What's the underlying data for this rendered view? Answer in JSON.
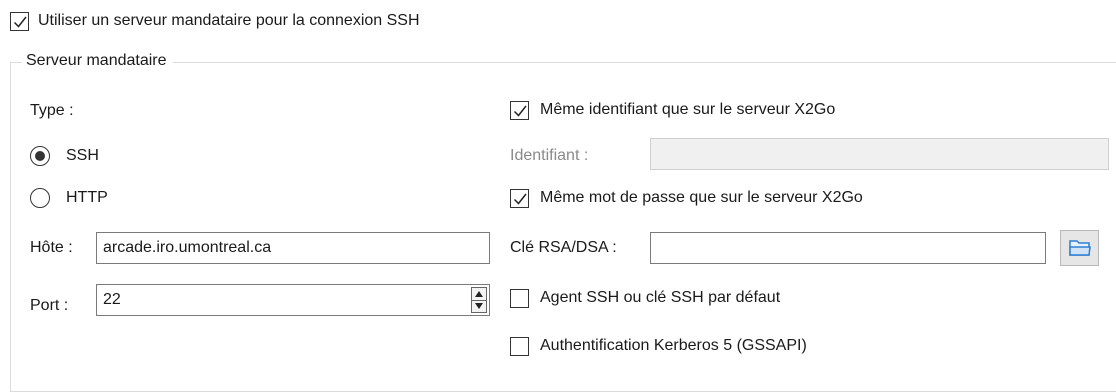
{
  "use_proxy": {
    "label": "Utiliser un serveur mandataire pour la connexion SSH",
    "checked": true
  },
  "group_title": "Serveur mandataire",
  "type_label": "Type :",
  "radio_ssh": {
    "label": "SSH",
    "selected": true
  },
  "radio_http": {
    "label": "HTTP",
    "selected": false
  },
  "host": {
    "label": "Hôte :",
    "value": "arcade.iro.umontreal.ca"
  },
  "port": {
    "label": "Port :",
    "value": "22"
  },
  "same_login": {
    "label": "Même identifiant que sur le serveur X2Go",
    "checked": true
  },
  "login": {
    "label": "Identifiant :",
    "value": ""
  },
  "same_password": {
    "label": "Même mot de passe que sur le serveur X2Go",
    "checked": true
  },
  "rsa": {
    "label": "Clé RSA/DSA :",
    "value": ""
  },
  "ssh_agent": {
    "label": "Agent SSH ou clé SSH par défaut",
    "checked": false
  },
  "kerberos": {
    "label": "Authentification Kerberos 5 (GSSAPI)",
    "checked": false
  },
  "icons": {
    "browse": "folder-open-icon",
    "check": "checkmark-icon",
    "spin_up": "arrow-up-icon",
    "spin_down": "arrow-down-icon"
  },
  "colors": {
    "accent_folder": "#2f7fd1",
    "border": "#7a7a7a",
    "disabled_bg": "#f0f0f0"
  }
}
